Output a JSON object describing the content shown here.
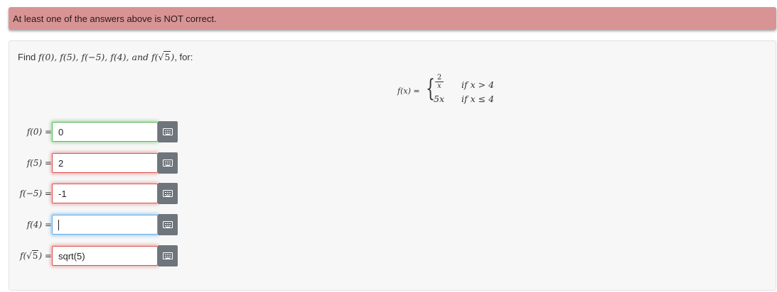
{
  "alert": {
    "message": "At least one of the answers above is NOT correct."
  },
  "problem": {
    "prompt_prefix": "Find ",
    "prompt_list": "f(0), f(5), f(−5), f(4), and ",
    "prompt_sqrt_pre": "f(",
    "prompt_sqrt_rad": "5",
    "prompt_sqrt_post": ")",
    "prompt_suffix": ", for:",
    "function": {
      "lhs": "f(x) =",
      "case1_numerator": "2",
      "case1_denominator": "x",
      "case1_condition": "if x > 4",
      "case2_expr": "5x",
      "case2_condition": "if x ≤ 4"
    }
  },
  "answers": [
    {
      "label": "f(0) =",
      "value": "0",
      "status": "correct"
    },
    {
      "label": "f(5) =",
      "value": "2",
      "status": "incorrect"
    },
    {
      "label": "f(−5) =",
      "value": "-1",
      "status": "incorrect"
    },
    {
      "label": "f(4) =",
      "value": "",
      "status": "focused"
    },
    {
      "label_pre": "f(",
      "label_rad": "5",
      "label_post": ") =",
      "value": "sqrt(5)",
      "status": "incorrect"
    }
  ],
  "icons": {
    "keyboard": "keyboard-icon"
  },
  "colors": {
    "alert_bg": "#d89494",
    "correct": "#5cb85c",
    "incorrect": "#d9534f",
    "focus": "#66afe9",
    "button": "#6f757c"
  }
}
